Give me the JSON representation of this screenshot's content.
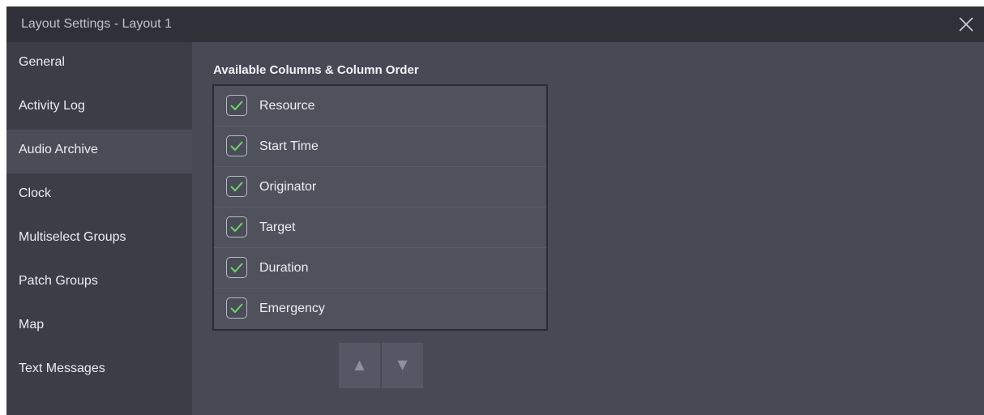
{
  "window": {
    "title": "Layout Settings - Layout 1",
    "close_icon": "close-icon"
  },
  "sidebar": {
    "active_index": 2,
    "items": [
      {
        "label": "General"
      },
      {
        "label": "Activity Log"
      },
      {
        "label": "Audio Archive"
      },
      {
        "label": "Clock"
      },
      {
        "label": "Multiselect Groups"
      },
      {
        "label": "Patch Groups"
      },
      {
        "label": "Map"
      },
      {
        "label": "Text Messages"
      }
    ]
  },
  "content": {
    "section_title": "Available Columns & Column Order",
    "columns": [
      {
        "label": "Resource",
        "checked": true
      },
      {
        "label": "Start Time",
        "checked": true
      },
      {
        "label": "Originator",
        "checked": true
      },
      {
        "label": "Target",
        "checked": true
      },
      {
        "label": "Duration",
        "checked": true
      },
      {
        "label": "Emergency",
        "checked": true
      }
    ],
    "move_up": {
      "glyph": "▲",
      "icon": "arrow-up-icon"
    },
    "move_down": {
      "glyph": "▼",
      "icon": "arrow-down-icon"
    }
  },
  "colors": {
    "titlebar_bg": "#2f3038",
    "sidebar_bg": "#3b3d47",
    "sidebar_active_bg": "#4a4c58",
    "content_bg": "#474955",
    "list_bg": "#4f515d",
    "checkmark": "#6fd36a"
  }
}
